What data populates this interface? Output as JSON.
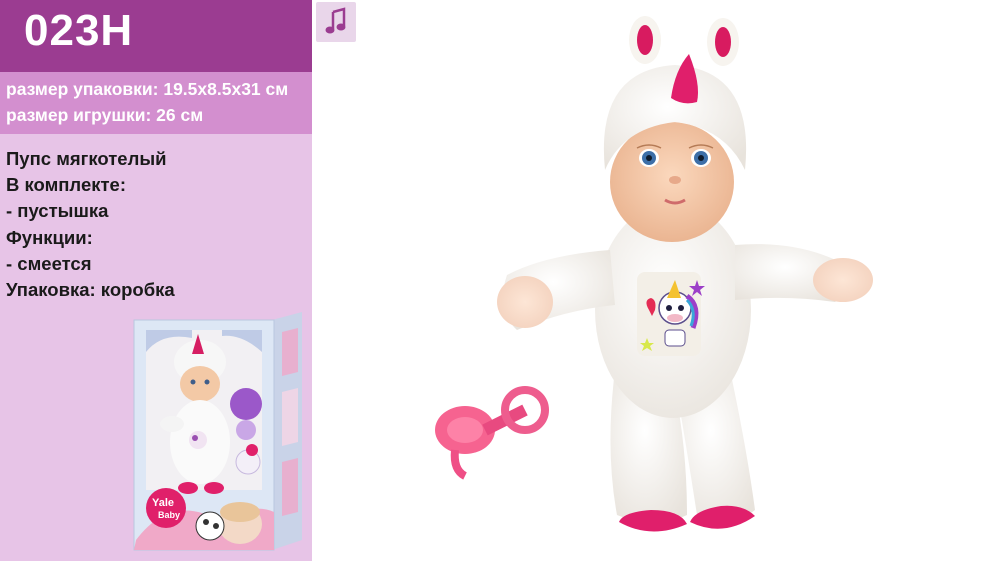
{
  "product": {
    "code": "023H",
    "package_size": "размер упаковки: 19.5x8.5x31 см",
    "toy_size": "размер игрушки: 26 см"
  },
  "description": [
    "Пупс мягкотелый",
    "В комплекте:",
    "- пустышка",
    "Функции:",
    "- смеется",
    "Упаковка: коробка"
  ],
  "box_brand": {
    "line1": "Yale",
    "line2": "Baby"
  },
  "icons": {
    "music": "music-note-icon"
  },
  "colors": {
    "header": "#9b3c91",
    "subheader": "#d38fcf",
    "panel": "#e7c4e7",
    "accent_pink": "#e0206a"
  }
}
